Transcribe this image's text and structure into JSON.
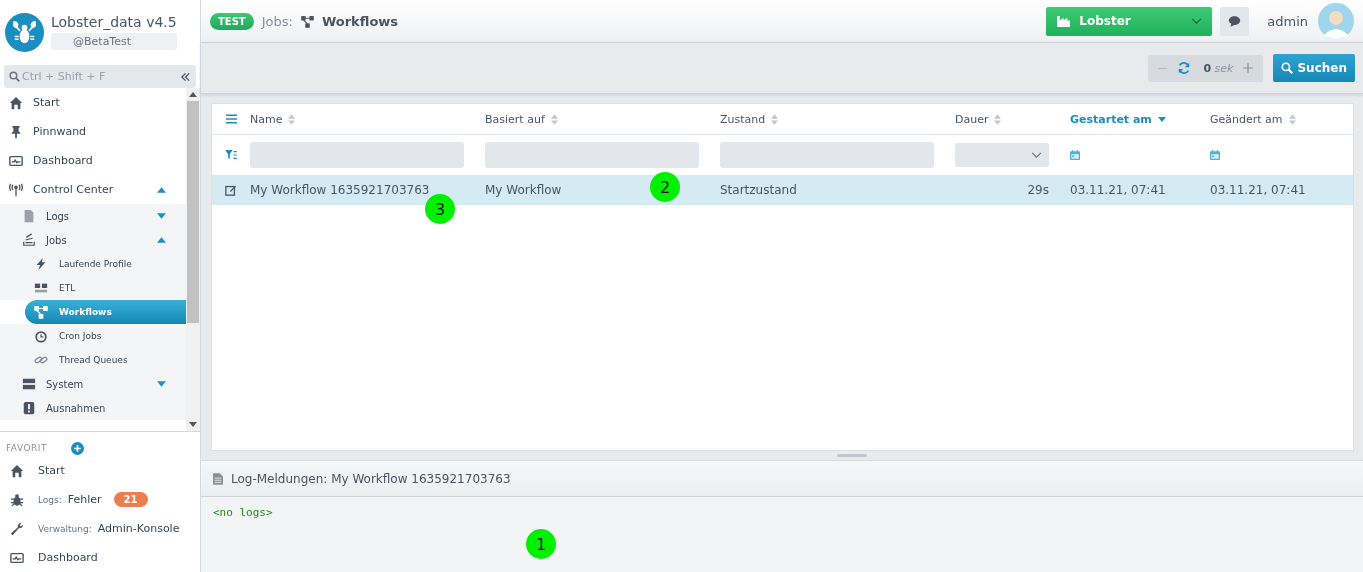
{
  "app": {
    "title": "Lobster_data v4.5",
    "tag": "@BetaTest"
  },
  "search": {
    "placeholder": "Ctrl + Shift + F"
  },
  "nav": [
    {
      "label": "Start",
      "selected": false
    },
    {
      "label": "Pinnwand",
      "selected": false
    },
    {
      "label": "Dashboard",
      "selected": false
    },
    {
      "label": "Control Center",
      "selected": false,
      "expanded": true,
      "children": [
        {
          "label": "Logs",
          "selected": false,
          "expanded": false
        },
        {
          "label": "Jobs",
          "selected": false,
          "expanded": true,
          "children": [
            {
              "label": "Laufende Profile",
              "selected": false
            },
            {
              "label": "ETL",
              "selected": false
            },
            {
              "label": "Workflows",
              "selected": true
            },
            {
              "label": "Cron Jobs",
              "selected": false
            },
            {
              "label": "Thread Queues",
              "selected": false
            }
          ]
        },
        {
          "label": "System",
          "selected": false,
          "expanded": false
        },
        {
          "label": "Ausnahmen",
          "selected": false
        }
      ]
    }
  ],
  "favorites": {
    "title": "FAVORIT",
    "items": [
      {
        "label": "Start"
      },
      {
        "prefix": "Logs:",
        "label": "Fehler",
        "badge": "21"
      },
      {
        "prefix": "Verwaltung:",
        "label": "Admin-Konsole"
      },
      {
        "label": "Dashboard"
      }
    ]
  },
  "header": {
    "env": "TEST",
    "section": "Jobs:",
    "page": "Workflows",
    "tenant": "Lobster",
    "user": "admin"
  },
  "toolbar": {
    "interval": "0",
    "unit": "sek",
    "search_button": "Suchen"
  },
  "table": {
    "columns": [
      {
        "label": "Name",
        "sorted": false,
        "kind": "text"
      },
      {
        "label": "Basiert auf",
        "sorted": false,
        "kind": "text"
      },
      {
        "label": "Zustand",
        "sorted": false,
        "kind": "text"
      },
      {
        "label": "Dauer",
        "sorted": false,
        "kind": "select"
      },
      {
        "label": "Gestartet am",
        "sorted": true,
        "kind": "date"
      },
      {
        "label": "Geändert am",
        "sorted": false,
        "kind": "date"
      }
    ],
    "rows": [
      {
        "selected": true,
        "cells": [
          "My Workflow 1635921703763",
          "My Workflow",
          "Startzustand",
          "29s",
          "03.11.21, 07:41",
          "03.11.21, 07:41"
        ]
      }
    ]
  },
  "log": {
    "title": "Log-Meldungen: My Workflow 1635921703763",
    "text": "<no logs>"
  },
  "markers": [
    {
      "label": "1"
    },
    {
      "label": "2"
    },
    {
      "label": "3"
    }
  ]
}
